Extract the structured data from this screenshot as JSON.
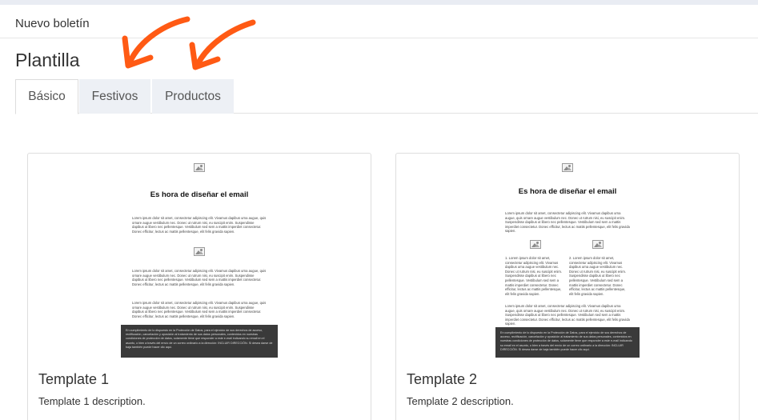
{
  "header": {
    "title": "Nuevo boletín"
  },
  "page": {
    "title": "Plantilla"
  },
  "tabs": [
    {
      "label": "Básico",
      "active": true
    },
    {
      "label": "Festivos",
      "active": false
    },
    {
      "label": "Productos",
      "active": false
    }
  ],
  "annotations": {
    "arrow_color": "#ff5a14"
  },
  "templates": [
    {
      "title": "Template 1",
      "description": "Template 1 description.",
      "preview": {
        "heading": "Es hora de diseñar el email",
        "paragraph": "Lorem ipsum dolor sit amet, consectetur adipiscing elit. Vivamus dapibus urna augue, quis ornare augue vestibulum nec. Donec ut rutrum nisi, eu suscipit enim. Suspendisse dapibus ut libero nec pellentesque. Vestibulum sed sem a mattis imperdiet consectetur. Donec efficitur, lectus ac mattis pellentesque, elit felis gravida sapien.",
        "footer": "En cumplimiento de lo dispuesto en la Protección de Datos, para el ejercicio de sus derechos de acceso, rectificación, cancelación y oposición al tratamiento de sus datos personales, contenidos en nuestras condiciones de protección de datos, solamente tiene que responder a este e-mail indicando su email en el asunto, o bien a través del envío de un correo ordinario a la dirección: INCLUIR DIRECCIÓN. Si desea darse de baja también puede hacer clic aquí."
      }
    },
    {
      "title": "Template 2",
      "description": "Template 2 description.",
      "preview": {
        "heading": "Es hora de diseñar el email",
        "paragraph": "Lorem ipsum dolor sit amet, consectetur adipiscing elit. Vivamus dapibus urna augue, quis ornare augue vestibulum nec. Donec ut rutrum nisi, eu suscipit enim. Suspendisse dapibus ut libero nec pellentesque. Vestibulum sed sem a mattis imperdiet consectetur. Donec efficitur, lectus ac mattis pellentesque, elit felis gravida sapien.",
        "col1": "1. Lorem ipsum dolor sit amet, consectetur adipiscing elit. Vivamus dapibus urna augue vestibulum nec. Donec ut rutrum nisi, eu suscipit enim. Suspendisse dapibus ut libero nec pellentesque. Vestibulum sed sem a mattis imperdiet consectetur. Donec efficitur, lectus ac mattis pellentesque, elit felis gravida sapien.",
        "col2": "2. Lorem ipsum dolor sit amet, consectetur adipiscing elit. Vivamus dapibus urna augue vestibulum nec. Donec ut rutrum nisi, eu suscipit enim. Suspendisse dapibus ut libero nec pellentesque. Vestibulum sed sem a mattis imperdiet consectetur. Donec efficitur, lectus ac mattis pellentesque, elit felis gravida sapien.",
        "footer": "En cumplimiento de lo dispuesto en la Protección de Datos, para el ejercicio de sus derechos de acceso, rectificación, cancelación y oposición al tratamiento de sus datos personales, contenidos en nuestras condiciones de protección de datos, solamente tiene que responder a este e-mail indicando su email en el asunto, o bien a través del envío de un correo ordinario a la dirección: INCLUIR DIRECCIÓN. Si desea darse de baja también puede hacer clic aquí."
      }
    }
  ]
}
